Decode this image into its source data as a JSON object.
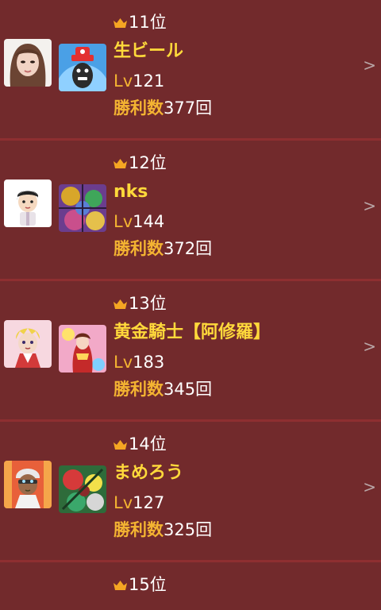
{
  "colors": {
    "background": "#722a2c",
    "divider": "#8e2f31",
    "name": "#ffd93b",
    "label": "#f4b432"
  },
  "labels": {
    "lv": "Lv",
    "wins": "勝利数",
    "wins_suffix": "回",
    "chevron": ">"
  },
  "rows": [
    {
      "rank": "11位",
      "name": "生ビール",
      "level": "121",
      "wins": "377"
    },
    {
      "rank": "12位",
      "name": "nks",
      "level": "144",
      "wins": "372"
    },
    {
      "rank": "13位",
      "name": "黄金騎士【阿修羅】",
      "level": "183",
      "wins": "345"
    },
    {
      "rank": "14位",
      "name": "まめろう",
      "level": "127",
      "wins": "325"
    },
    {
      "rank": "15位"
    }
  ],
  "icons": [
    "crown-icon",
    "chevron-right-icon",
    "player-avatar",
    "monster-card"
  ]
}
